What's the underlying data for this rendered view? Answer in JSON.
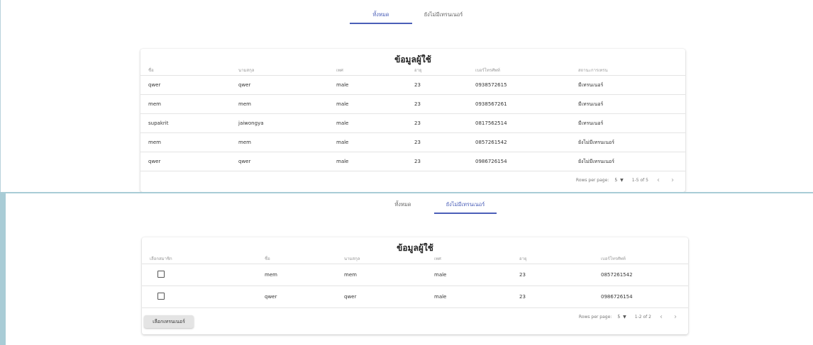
{
  "top": {
    "tabs": [
      {
        "label": "ทั้งหมด",
        "active": true
      },
      {
        "label": "ยังไม่มีเทรนเนอร์",
        "active": false
      }
    ],
    "card_title": "ข้อมูลผู้ใช้",
    "columns": [
      "ชื่อ",
      "นามสกุล",
      "เพศ",
      "อายุ",
      "เบอร์โทรศัพท์",
      "สถานะการเทรน"
    ],
    "rows": [
      [
        "qwer",
        "qwer",
        "male",
        "23",
        "0938572615",
        "มีเทรนเนอร์"
      ],
      [
        "mem",
        "mem",
        "male",
        "23",
        "0938567261",
        "มีเทรนเนอร์"
      ],
      [
        "supakrit",
        "jaiwongya",
        "male",
        "23",
        "0817562514",
        "มีเทรนเนอร์"
      ],
      [
        "mem",
        "mem",
        "male",
        "23",
        "0857261542",
        "ยังไม่มีเทรนเนอร์"
      ],
      [
        "qwer",
        "qwer",
        "male",
        "23",
        "0986726154",
        "ยังไม่มีเทรนเนอร์"
      ]
    ],
    "pagination": {
      "rows_label": "Rows per page:",
      "rows_value": "5",
      "range": "1-5 of 5"
    }
  },
  "bottom": {
    "tabs": [
      {
        "label": "ทั้งหมด",
        "active": false
      },
      {
        "label": "ยังไม่มีเทรนเนอร์",
        "active": true
      }
    ],
    "card_title": "ข้อมูลผู้ใช้",
    "columns": [
      "เลือกสมาชิก",
      "ชื่อ",
      "นามสกุล",
      "เพศ",
      "อายุ",
      "เบอร์โทรศัพท์"
    ],
    "rows": [
      [
        "mem",
        "mem",
        "male",
        "23",
        "0857261542"
      ],
      [
        "qwer",
        "qwer",
        "male",
        "23",
        "0986726154"
      ]
    ],
    "pagination": {
      "rows_label": "Rows per page:",
      "rows_value": "5",
      "range": "1-2 of 2"
    },
    "select_button": "เลือกเทรนเนอร์"
  },
  "icons": {
    "dropdown": "caret-down-icon",
    "prev": "chevron-left-icon",
    "next": "chevron-right-icon"
  },
  "colors": {
    "accent": "#4b5fb8",
    "frame": "#a9ccd6"
  }
}
